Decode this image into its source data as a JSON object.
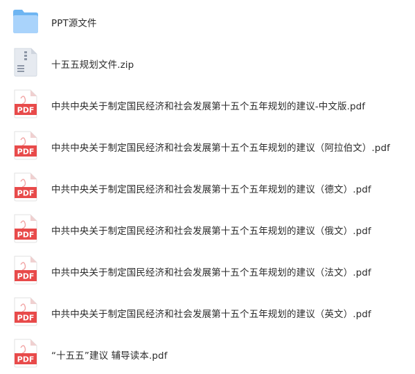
{
  "files": [
    {
      "name": "PPT源文件",
      "icon": "folder-icon"
    },
    {
      "name": "十五五规划文件.zip",
      "icon": "zip-archive-icon"
    },
    {
      "name": "中共中央关于制定国民经济和社会发展第十五个五年规划的建议-中文版.pdf",
      "icon": "pdf-file-icon"
    },
    {
      "name": "中共中央关于制定国民经济和社会发展第十五个五年规划的建议（阿拉伯文）.pdf",
      "icon": "pdf-file-icon"
    },
    {
      "name": "中共中央关于制定国民经济和社会发展第十五个五年规划的建议（德文）.pdf",
      "icon": "pdf-file-icon"
    },
    {
      "name": "中共中央关于制定国民经济和社会发展第十五个五年规划的建议（俄文）.pdf",
      "icon": "pdf-file-icon"
    },
    {
      "name": "中共中央关于制定国民经济和社会发展第十五个五年规划的建议（法文）.pdf",
      "icon": "pdf-file-icon"
    },
    {
      "name": "中共中央关于制定国民经济和社会发展第十五个五年规划的建议（英文）.pdf",
      "icon": "pdf-file-icon"
    },
    {
      "name": "“十五五”建议 辅导读本.pdf",
      "icon": "pdf-file-icon"
    }
  ],
  "pdf_icon_label": "PDF",
  "colors": {
    "folder": "#6eb5f2",
    "folder_light": "#a9d3fb",
    "pdf_red": "#e84a4a",
    "zip_gray": "#dfe4ec"
  }
}
